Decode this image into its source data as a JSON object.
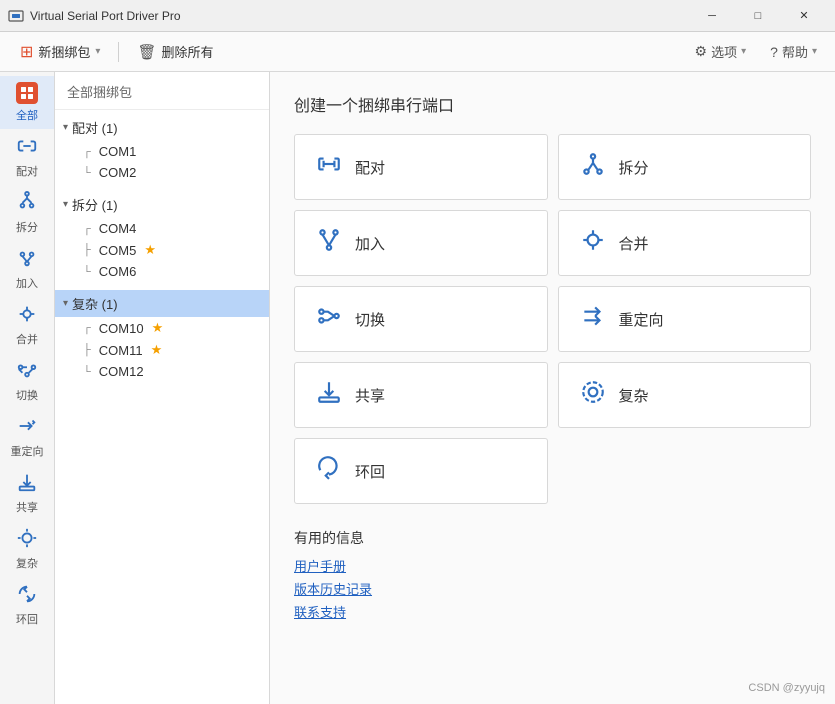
{
  "titleBar": {
    "title": "Virtual Serial Port Driver Pro",
    "icon": "⊞",
    "minimize": "─",
    "maximize": "□",
    "close": "✕"
  },
  "toolbar": {
    "newBundle": "新捆绑包",
    "deleteAll": "删除所有",
    "options": "选项",
    "help": "帮助",
    "dropdownArrow": "▾"
  },
  "sidebar": {
    "header": "全部捆绑包",
    "navItems": [
      {
        "id": "all",
        "label": "全部",
        "active": true
      },
      {
        "id": "pair",
        "label": "配对",
        "active": false
      },
      {
        "id": "split",
        "label": "拆分",
        "active": false
      },
      {
        "id": "join",
        "label": "加入",
        "active": false
      },
      {
        "id": "merge",
        "label": "合并",
        "active": false
      },
      {
        "id": "switch",
        "label": "切换",
        "active": false
      },
      {
        "id": "redirect",
        "label": "重定向",
        "active": false
      },
      {
        "id": "share",
        "label": "共享",
        "active": false
      },
      {
        "id": "complex",
        "label": "复杂",
        "active": false
      },
      {
        "id": "loopback",
        "label": "环回",
        "active": false
      }
    ],
    "groups": [
      {
        "id": "pair-group",
        "label": "配对 (1)",
        "expanded": true,
        "selected": false,
        "items": [
          {
            "id": "com1",
            "label": "COM1",
            "star": false,
            "selected": false,
            "connector": "┌"
          },
          {
            "id": "com2",
            "label": "COM2",
            "star": false,
            "selected": false,
            "connector": "└"
          }
        ]
      },
      {
        "id": "split-group",
        "label": "拆分 (1)",
        "expanded": true,
        "selected": false,
        "items": [
          {
            "id": "com4",
            "label": "COM4",
            "star": false,
            "selected": false,
            "connector": "┌"
          },
          {
            "id": "com5",
            "label": "COM5",
            "star": true,
            "selected": false,
            "connector": "├"
          },
          {
            "id": "com6",
            "label": "COM6",
            "star": false,
            "selected": false,
            "connector": "└"
          }
        ]
      },
      {
        "id": "complex-group",
        "label": "复杂 (1)",
        "expanded": true,
        "selected": true,
        "items": [
          {
            "id": "com10",
            "label": "COM10",
            "star": true,
            "selected": false,
            "connector": "┌"
          },
          {
            "id": "com11",
            "label": "COM11",
            "star": true,
            "selected": false,
            "connector": "├"
          },
          {
            "id": "com12",
            "label": "COM12",
            "star": false,
            "selected": false,
            "connector": "└"
          }
        ]
      }
    ]
  },
  "mainPanel": {
    "title": "创建一个捆绑串行端口",
    "portTypes": [
      {
        "id": "pair",
        "label": "配对",
        "icon": "pair"
      },
      {
        "id": "split",
        "label": "拆分",
        "icon": "split"
      },
      {
        "id": "join",
        "label": "加入",
        "icon": "join"
      },
      {
        "id": "merge",
        "label": "合并",
        "icon": "merge"
      },
      {
        "id": "switch",
        "label": "切换",
        "icon": "switch"
      },
      {
        "id": "redirect",
        "label": "重定向",
        "icon": "redirect"
      },
      {
        "id": "share",
        "label": "共享",
        "icon": "share"
      },
      {
        "id": "complex",
        "label": "复杂",
        "icon": "complex"
      },
      {
        "id": "loopback",
        "label": "环回",
        "icon": "loopback"
      }
    ],
    "infoSection": {
      "title": "有用的信息",
      "links": [
        {
          "id": "user-manual",
          "label": "用户手册"
        },
        {
          "id": "version-history",
          "label": "版本历史记录"
        },
        {
          "id": "contact-support",
          "label": "联系支持"
        }
      ]
    }
  },
  "watermark": "CSDN @zyyujq"
}
